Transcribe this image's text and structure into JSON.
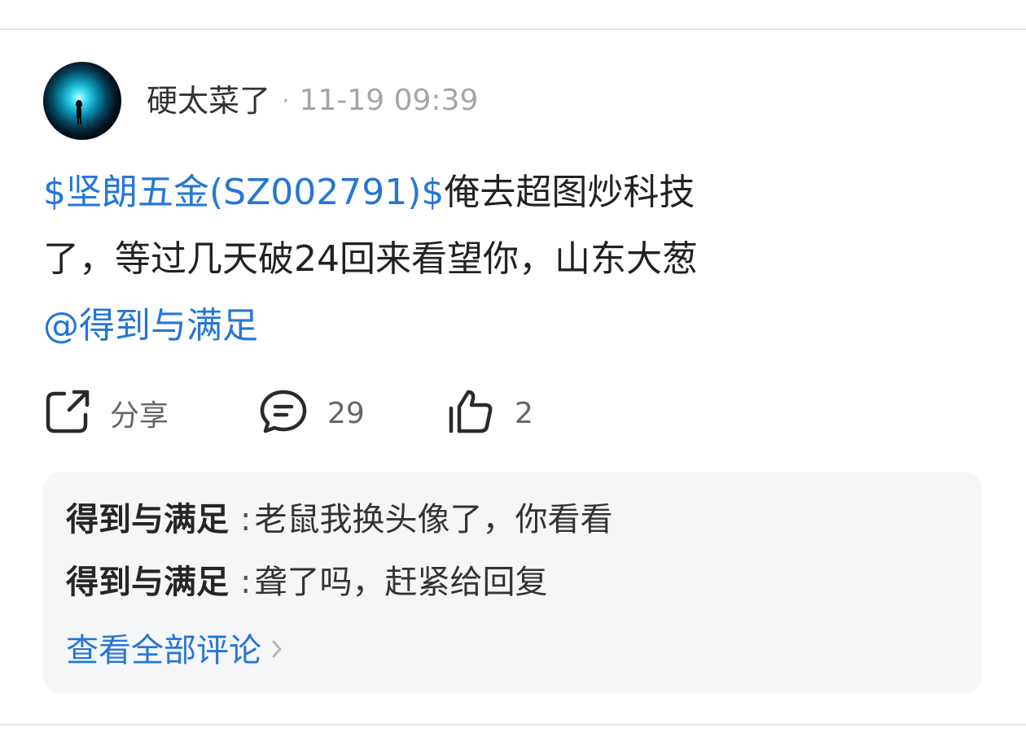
{
  "post": {
    "author": "硬太菜了",
    "separator": "·",
    "time": "11-19 09:39",
    "content": {
      "stock_tag": "$坚朗五金(SZ002791)$",
      "text_after_tag": "俺去超图炒科技",
      "line2": "了，等过几天破24回来看望你，山东大葱",
      "mention": "@得到与满足"
    }
  },
  "actions": {
    "share_label": "分享",
    "comment_count": "29",
    "like_count": "2"
  },
  "comments": [
    {
      "user": "得到与满足",
      "colon": ":",
      "text": "老鼠我换头像了，你看看"
    },
    {
      "user": "得到与满足",
      "colon": ":",
      "text": "聋了吗，赶紧给回复"
    }
  ],
  "view_all_label": "查看全部评论",
  "colors": {
    "link": "#2576d6",
    "text": "#222222",
    "muted": "#a5a5a5",
    "panel": "#f5f6f8"
  },
  "icons": {
    "share": "share-icon",
    "comment": "comment-icon",
    "like": "thumbs-up-icon",
    "chevron": "chevron-right-icon"
  }
}
